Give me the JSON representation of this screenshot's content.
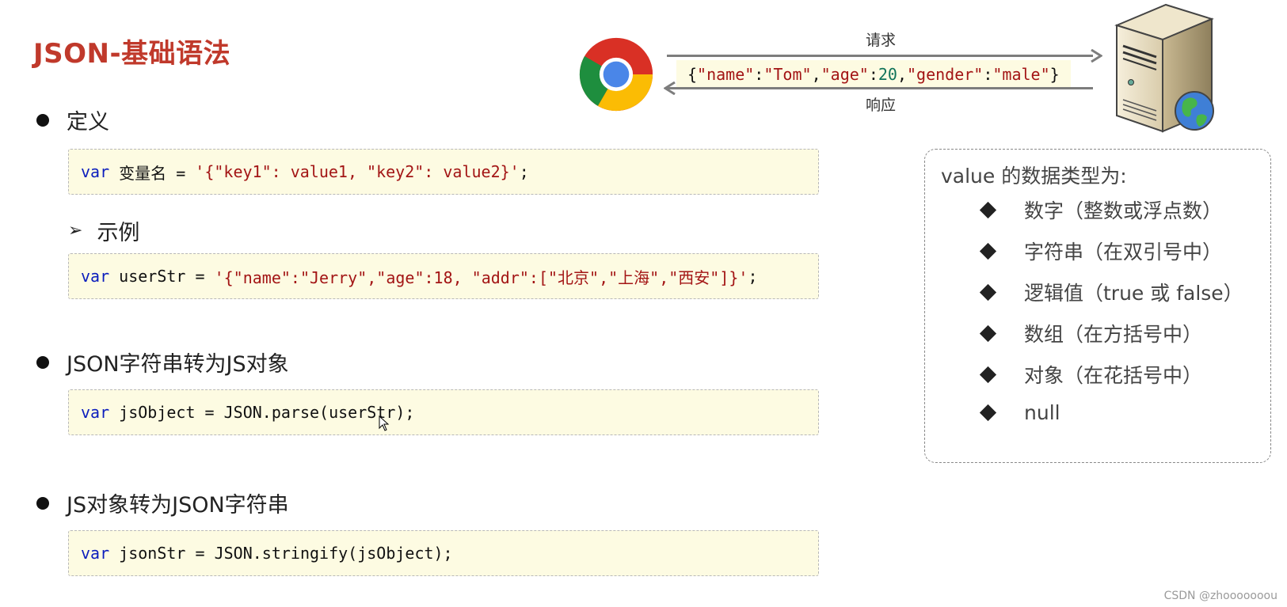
{
  "slide": {
    "title": "JSON-基础语法",
    "watermark": "CSDN @zhooooooou"
  },
  "sections": {
    "definition": {
      "label": "定义",
      "code": {
        "kw": "var",
        "rest": " 变量名 = ",
        "str": "'{\"key1\": value1, \"key2\": value2}'",
        "end": ";"
      }
    },
    "example": {
      "label": "示例",
      "code": {
        "kw": "var",
        "rest": " userStr = ",
        "str": "'{\"name\":\"Jerry\",\"age\":18, \"addr\":[\"北京\",\"上海\",\"西安\"]}'",
        "end": ";"
      }
    },
    "parse": {
      "label": "JSON字符串转为JS对象",
      "code": {
        "kw": "var",
        "rest": " jsObject = JSON.parse(userStr);"
      }
    },
    "stringify": {
      "label": "JS对象转为JSON字符串",
      "code": {
        "kw": "var",
        "rest": " jsonStr = JSON.stringify(jsObject);"
      }
    }
  },
  "diagram": {
    "request_label": "请求",
    "response_label": "响应",
    "json_parts": {
      "open": "{",
      "k1": "\"name\"",
      "c1": ":",
      "v1": "\"Tom\"",
      "s1": ",",
      "k2": "\"age\"",
      "c2": ":",
      "v2": "20",
      "s2": ",",
      "k3": "\"gender\"",
      "c3": ":",
      "v3": "\"male\"",
      "close": "}"
    },
    "client_icon": "chrome-browser-icon",
    "server_icon": "web-server-icon"
  },
  "value_types": {
    "title": "value 的数据类型为:",
    "items": [
      "数字（整数或浮点数）",
      "字符串（在双引号中）",
      "逻辑值（true 或 false）",
      "数组（在方括号中）",
      "对象（在花括号中）",
      "null"
    ]
  },
  "colors": {
    "title": "#c0392b",
    "keyword": "#0b1dbd",
    "string": "#a31515",
    "number": "#11745a",
    "code_bg": "#fdfbe2"
  }
}
